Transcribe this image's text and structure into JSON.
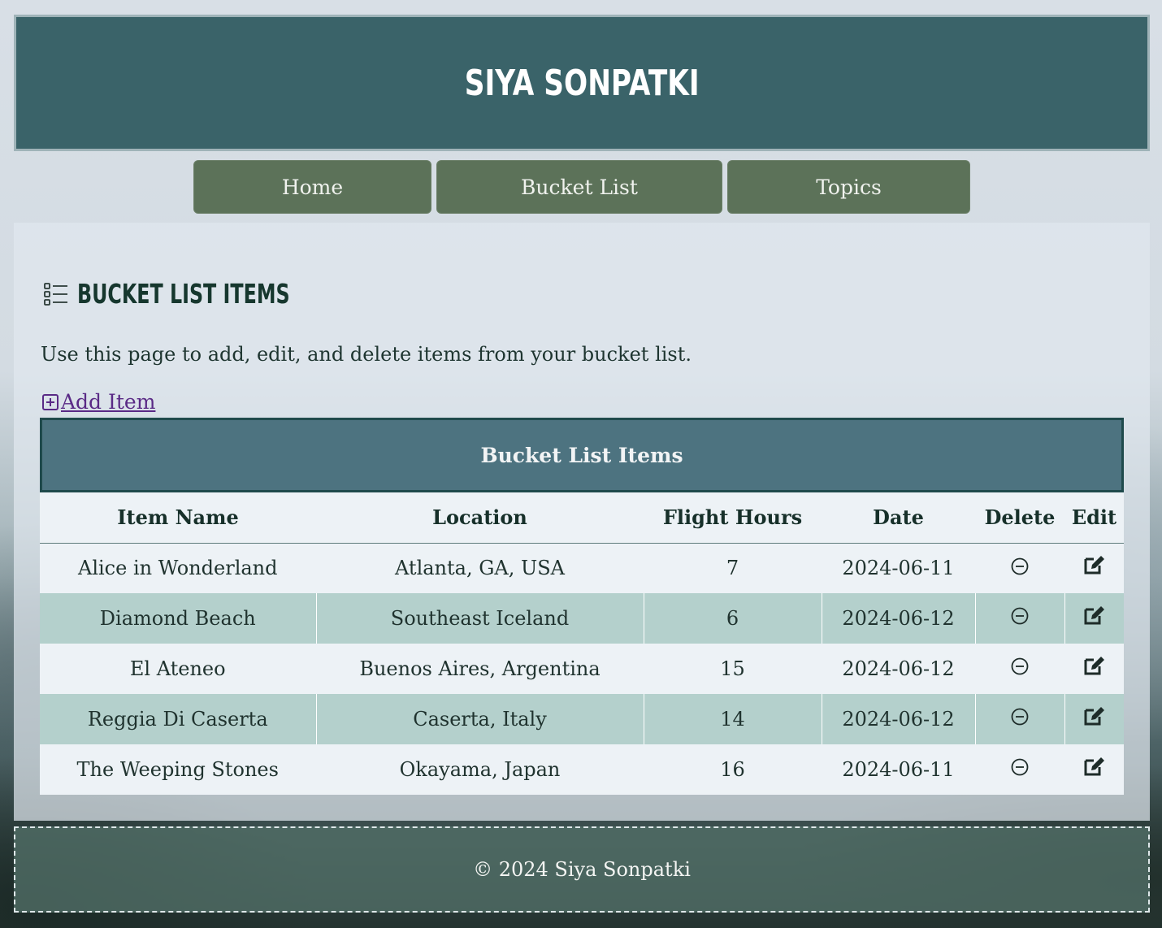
{
  "site": {
    "title": "Siya Sonpatki"
  },
  "nav": {
    "items": [
      {
        "label": "Home"
      },
      {
        "label": "Bucket List"
      },
      {
        "label": "Topics"
      }
    ]
  },
  "page": {
    "heading": "Bucket List Items",
    "heading_icon": "list-icon",
    "intro": "Use this page to add, edit, and delete items from your bucket list.",
    "add_item": {
      "label": "Add Item",
      "icon": "plus-square-icon"
    }
  },
  "table": {
    "caption": "Bucket List Items",
    "columns": [
      "Item Name",
      "Location",
      "Flight Hours",
      "Date",
      "Delete",
      "Edit"
    ],
    "rows": [
      {
        "name": "Alice in Wonderland",
        "location": "Atlanta, GA, USA",
        "flight_hours": "7",
        "date": "2024-06-11",
        "delete_icon": "minus-circle-icon",
        "edit_icon": "edit-icon"
      },
      {
        "name": "Diamond Beach",
        "location": "Southeast Iceland",
        "flight_hours": "6",
        "date": "2024-06-12",
        "delete_icon": "minus-circle-icon",
        "edit_icon": "edit-icon"
      },
      {
        "name": "El Ateneo",
        "location": "Buenos Aires, Argentina",
        "flight_hours": "15",
        "date": "2024-06-12",
        "delete_icon": "minus-circle-icon",
        "edit_icon": "edit-icon"
      },
      {
        "name": "Reggia Di Caserta",
        "location": "Caserta, Italy",
        "flight_hours": "14",
        "date": "2024-06-12",
        "delete_icon": "minus-circle-icon",
        "edit_icon": "edit-icon"
      },
      {
        "name": "The Weeping Stones",
        "location": "Okayama, Japan",
        "flight_hours": "16",
        "date": "2024-06-11",
        "delete_icon": "minus-circle-icon",
        "edit_icon": "edit-icon"
      }
    ]
  },
  "footer": {
    "text": "© 2024 Siya Sonpatki"
  },
  "colors": {
    "header_bg": "#3a6369",
    "nav_button_bg": "#5c7259",
    "table_caption_bg": "#4d7380",
    "row_alt_bg": "#b4d0cc",
    "row_bg": "#edf2f6",
    "link": "#5a2a86"
  }
}
